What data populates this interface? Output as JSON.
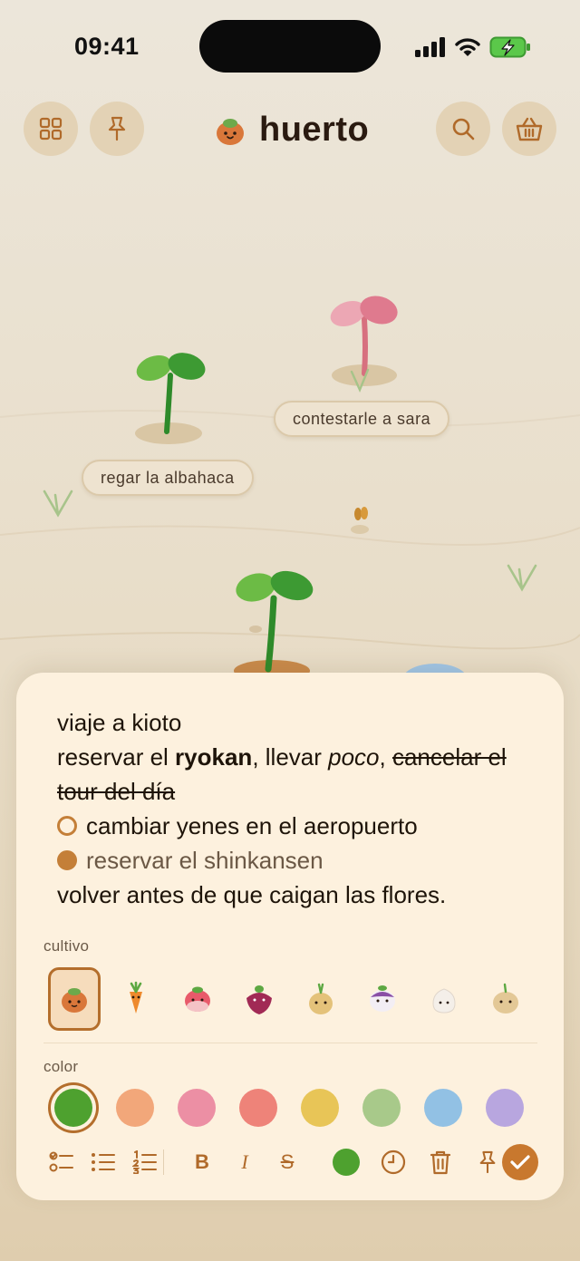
{
  "status_bar": {
    "time": "09:41",
    "icons": [
      "signal-icon",
      "wifi-icon",
      "battery-charging-icon"
    ]
  },
  "header": {
    "app_name": "huerto",
    "left_buttons": [
      "grid-icon",
      "pin-icon"
    ],
    "right_buttons": [
      "search-icon",
      "basket-icon"
    ]
  },
  "garden": {
    "labels": {
      "albahaca": "regar la albahaca",
      "sara": "contestarle a sara"
    }
  },
  "note": {
    "title": "viaje a kioto",
    "line2": {
      "t1": "reservar el ",
      "bold": "ryokan",
      "t2": ", llevar ",
      "italic": "poco",
      "t3": ", ",
      "strike_a": "cancelar el",
      "strike_b": "tour del día"
    },
    "tasks": [
      {
        "text": "cambiar yenes en el aeropuerto",
        "done": false
      },
      {
        "text": "reservar el shinkansen",
        "done": true
      }
    ],
    "closing": "volver antes de que caigan las flores."
  },
  "crop_section": {
    "label": "cultivo",
    "selected": "onion",
    "options": [
      "onion-icon",
      "carrot-icon",
      "radish-icon",
      "beet-icon",
      "yellow-onion-icon",
      "turnip-icon",
      "garlic-icon",
      "potato-icon"
    ]
  },
  "color_section": {
    "label": "color",
    "selected": "#4ea12f",
    "swatches": [
      "#4ea12f",
      "#f2a77a",
      "#ec8fa4",
      "#ee8379",
      "#e8c557",
      "#a8c98a",
      "#92c1e4",
      "#b8a6df"
    ]
  },
  "toolbar": {
    "items": [
      "checklist-icon",
      "bullet-list-icon",
      "numbered-list-icon",
      "bold-icon",
      "italic-icon",
      "strikethrough-icon",
      "color-dot",
      "clock-icon",
      "trash-icon",
      "pin-icon",
      "confirm-check-icon"
    ],
    "bold_glyph": "B",
    "italic_glyph": "I",
    "strike_glyph": "S",
    "accent": "#c8782e"
  }
}
